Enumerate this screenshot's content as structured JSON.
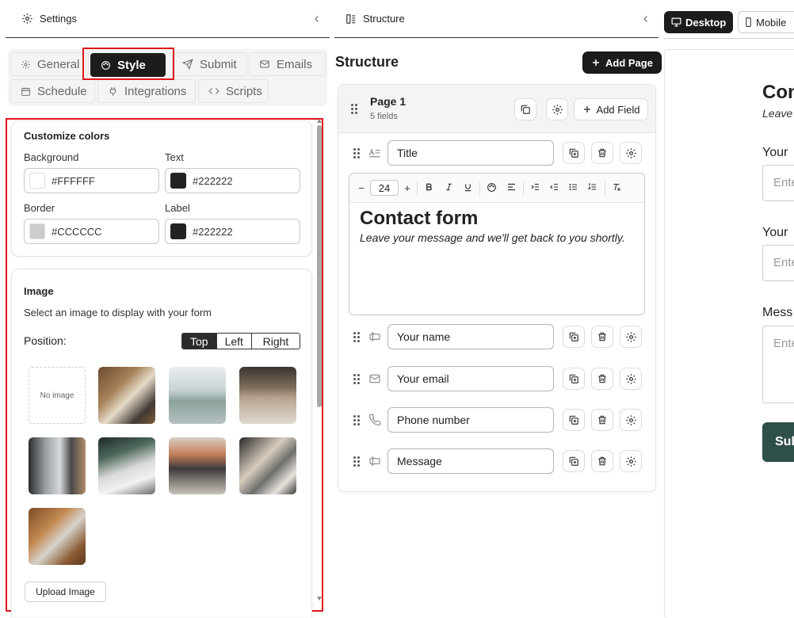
{
  "settings": {
    "title": "Settings",
    "tabs": {
      "general": "General",
      "style": "Style",
      "submit": "Submit",
      "emails": "Emails",
      "schedule": "Schedule",
      "integrations": "Integrations",
      "scripts": "Scripts"
    },
    "colors": {
      "title": "Customize colors",
      "background_label": "Background",
      "background_value": "#FFFFFF",
      "text_label": "Text",
      "text_value": "#222222",
      "border_label": "Border",
      "border_value": "#CCCCCC",
      "label_label": "Label",
      "label_value": "#222222"
    },
    "image": {
      "title": "Image",
      "description": "Select an image to display with your form",
      "position_label": "Position:",
      "positions": [
        "Top",
        "Left",
        "Right"
      ],
      "selected_position": "Top",
      "no_image": "No image",
      "upload_label": "Upload Image"
    }
  },
  "structure": {
    "title": "Structure",
    "heading": "Structure",
    "add_page": "Add Page",
    "page": {
      "name": "Page 1",
      "count": "5 fields",
      "add_field": "Add Field"
    },
    "fields": {
      "title": "Title",
      "name": "Your name",
      "email": "Your email",
      "phone": "Phone number",
      "message": "Message"
    },
    "editor": {
      "font_size": "24",
      "heading": "Contact form",
      "subtext": "Leave your message and we'll get back to you shortly."
    }
  },
  "preview": {
    "desktop_label": "Desktop",
    "mobile_label": "Mobile",
    "title_partial": "Con",
    "subtitle_partial": "Leave",
    "label1_partial": "Your",
    "placeholder1_partial": "Ente",
    "label2_partial": "Your",
    "placeholder2_partial": "Ente",
    "label3_partial": "Mess",
    "placeholder3_partial": "Ente",
    "submit_partial": "Sub"
  },
  "colors": {
    "accent_dark": "#1c1c1c",
    "highlight_red": "#e0161c",
    "submit_green": "#2f4f4a"
  }
}
